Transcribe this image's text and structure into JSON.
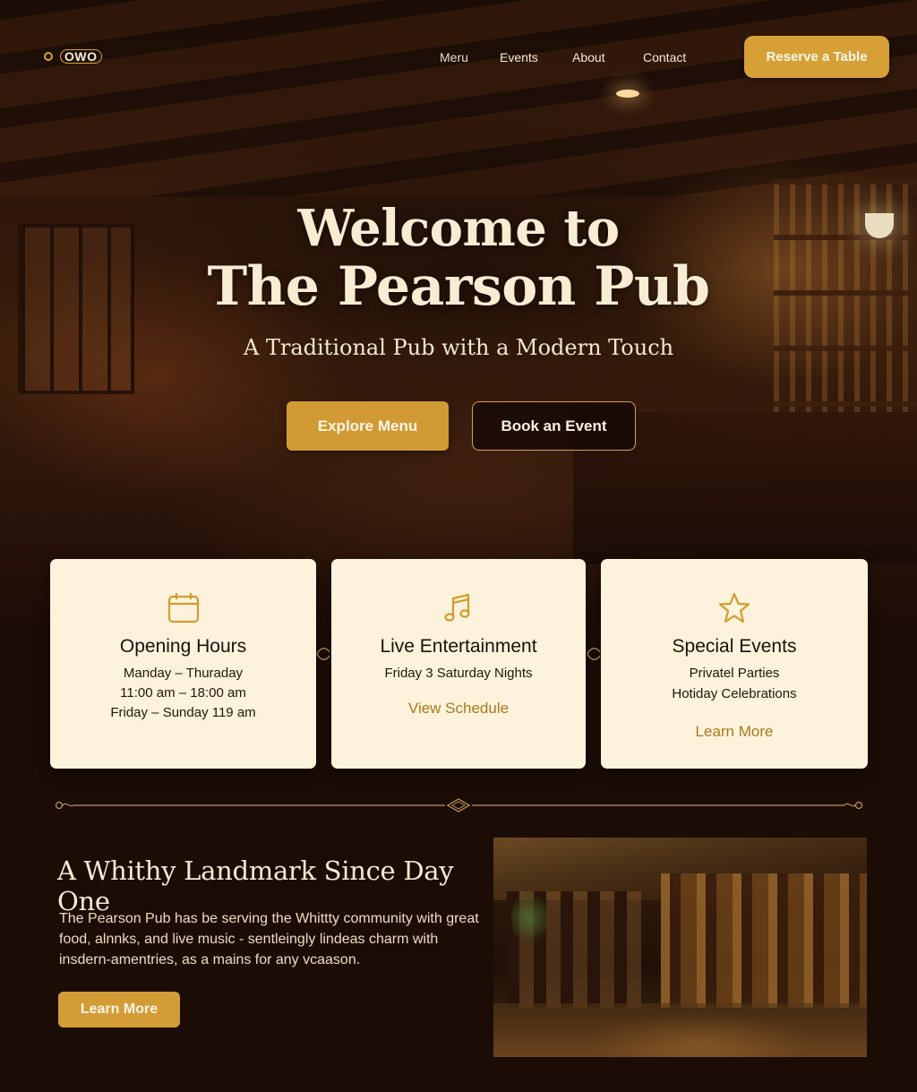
{
  "brand": {
    "logo_text": "OWO"
  },
  "nav": {
    "items": [
      {
        "label": "Meru"
      },
      {
        "label": "Events"
      },
      {
        "label": "About"
      },
      {
        "label": "Contact"
      }
    ],
    "cta_label": "Reserve a Table"
  },
  "hero": {
    "title_line1": "Welcome to",
    "title_line2": "The Pearson Pub",
    "subtitle": "A Traditional Pub with a Modern Touch",
    "primary_button": "Explore Menu",
    "secondary_button": "Book an Event"
  },
  "cards": [
    {
      "icon": "calendar-icon",
      "title": "Opening Hours",
      "lines": [
        "Manday – Thuraday",
        "11:00 am – 18:00 am",
        "Friday – Sunday 119 am"
      ],
      "link": ""
    },
    {
      "icon": "music-note-icon",
      "title": "Live Entertainment",
      "lines": [
        "Friday 3 Saturday Nights"
      ],
      "link": "View Schedule"
    },
    {
      "icon": "star-icon",
      "title": "Special Events",
      "lines": [
        "Privatel Parties",
        "Hotiday Celebrations"
      ],
      "link": "Learn More"
    }
  ],
  "about": {
    "title": "A Whithy Landmark Since Day One",
    "body_lines": [
      "The Pearson Pub has be serving the Whittty community with great",
      "food, alnnks, and live music - sentleingly  lindeas charm with",
      "insdern-amentries, as a mains for any vcaason."
    ],
    "button": "Learn More"
  },
  "colors": {
    "accent": "#d6a036",
    "card_bg": "#fdf3dc",
    "page_bg": "#1c0c06",
    "link_gold": "#a87a1c"
  }
}
